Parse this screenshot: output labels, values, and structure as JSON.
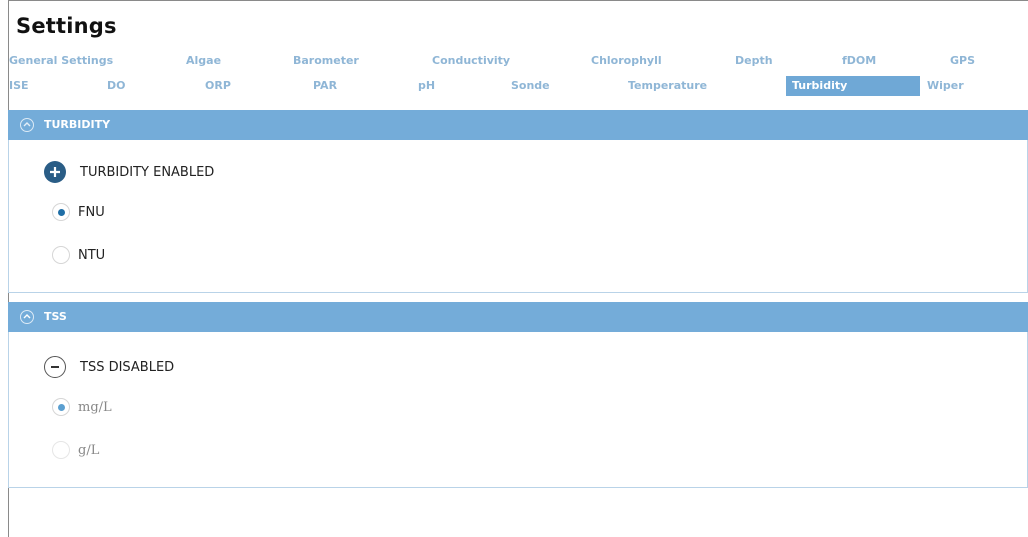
{
  "window": {
    "title": "Settings"
  },
  "tabs_row1": [
    {
      "label": "General Settings"
    },
    {
      "label": "Algae"
    },
    {
      "label": "Barometer"
    },
    {
      "label": "Conductivity"
    },
    {
      "label": "Chlorophyll"
    },
    {
      "label": "Depth"
    },
    {
      "label": "fDOM"
    },
    {
      "label": "GPS"
    }
  ],
  "tabs_row2": [
    {
      "label": "ISE"
    },
    {
      "label": "DO"
    },
    {
      "label": "ORP"
    },
    {
      "label": "PAR"
    },
    {
      "label": "pH"
    },
    {
      "label": "Sonde"
    },
    {
      "label": "Temperature"
    },
    {
      "label": "Turbidity",
      "active": true
    },
    {
      "label": "Wiper"
    }
  ],
  "turbidity": {
    "header": "TURBIDITY",
    "toggle_label": "TURBIDITY ENABLED",
    "enabled": true,
    "options": [
      {
        "label": "FNU",
        "selected": true
      },
      {
        "label": "NTU",
        "selected": false
      }
    ]
  },
  "tss": {
    "header": "TSS",
    "toggle_label": "TSS DISABLED",
    "enabled": false,
    "options": [
      {
        "label": "mg/L",
        "selected": true
      },
      {
        "label": "g/L",
        "selected": false
      }
    ]
  },
  "colors": {
    "section_header": "#74acd9",
    "active_tab": "#6fa8d6",
    "inactive_tab_text": "#8fb6d6",
    "plus_button": "#2a5d86"
  },
  "icons": {
    "plus": "plus-circle-icon",
    "minus": "minus-circle-icon",
    "collapse": "chevron-up-circle-icon"
  }
}
